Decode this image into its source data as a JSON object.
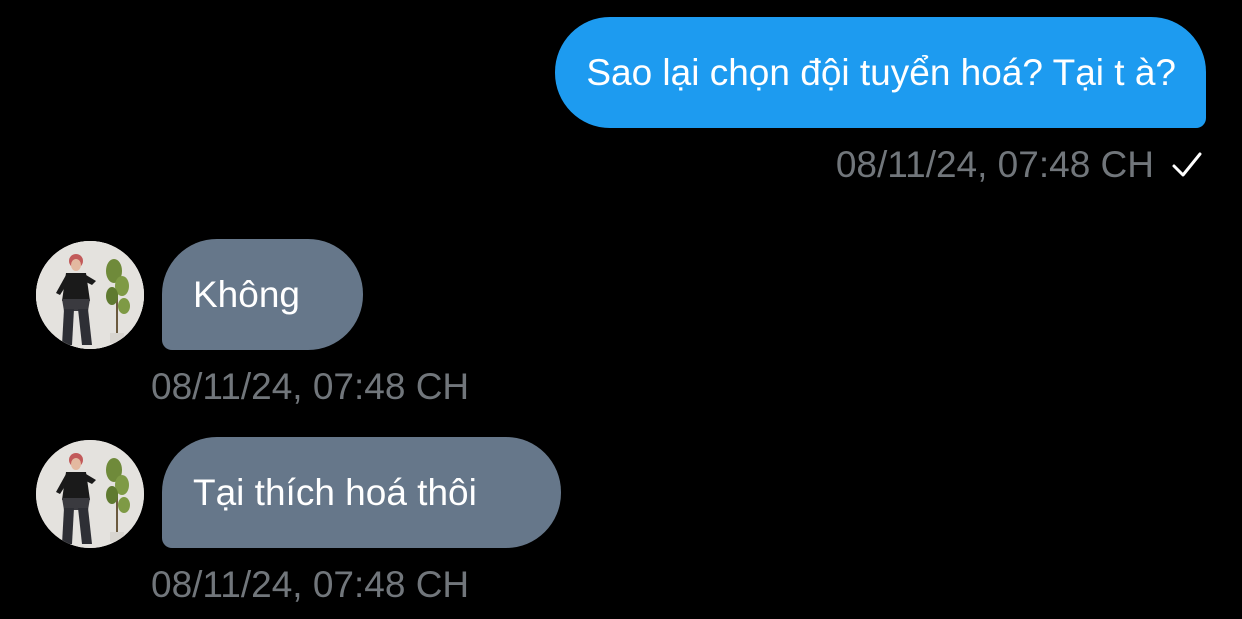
{
  "conversation": {
    "messages": [
      {
        "direction": "sent",
        "text": "Sao lại chọn đội tuyển hoá? Tại t à?",
        "timestamp": "08/11/24, 07:48 CH",
        "status_icon": "checkmark-icon"
      },
      {
        "direction": "received",
        "text": "Không",
        "timestamp": "08/11/24, 07:48 CH",
        "avatar": "user-avatar"
      },
      {
        "direction": "received",
        "text": "Tại thích hoá thôi",
        "timestamp": "08/11/24, 07:48 CH",
        "avatar": "user-avatar"
      }
    ]
  },
  "colors": {
    "background": "#000000",
    "sent_bubble": "#1d9bf0",
    "received_bubble": "#66778a",
    "timestamp": "#71767b",
    "text": "#ffffff"
  }
}
